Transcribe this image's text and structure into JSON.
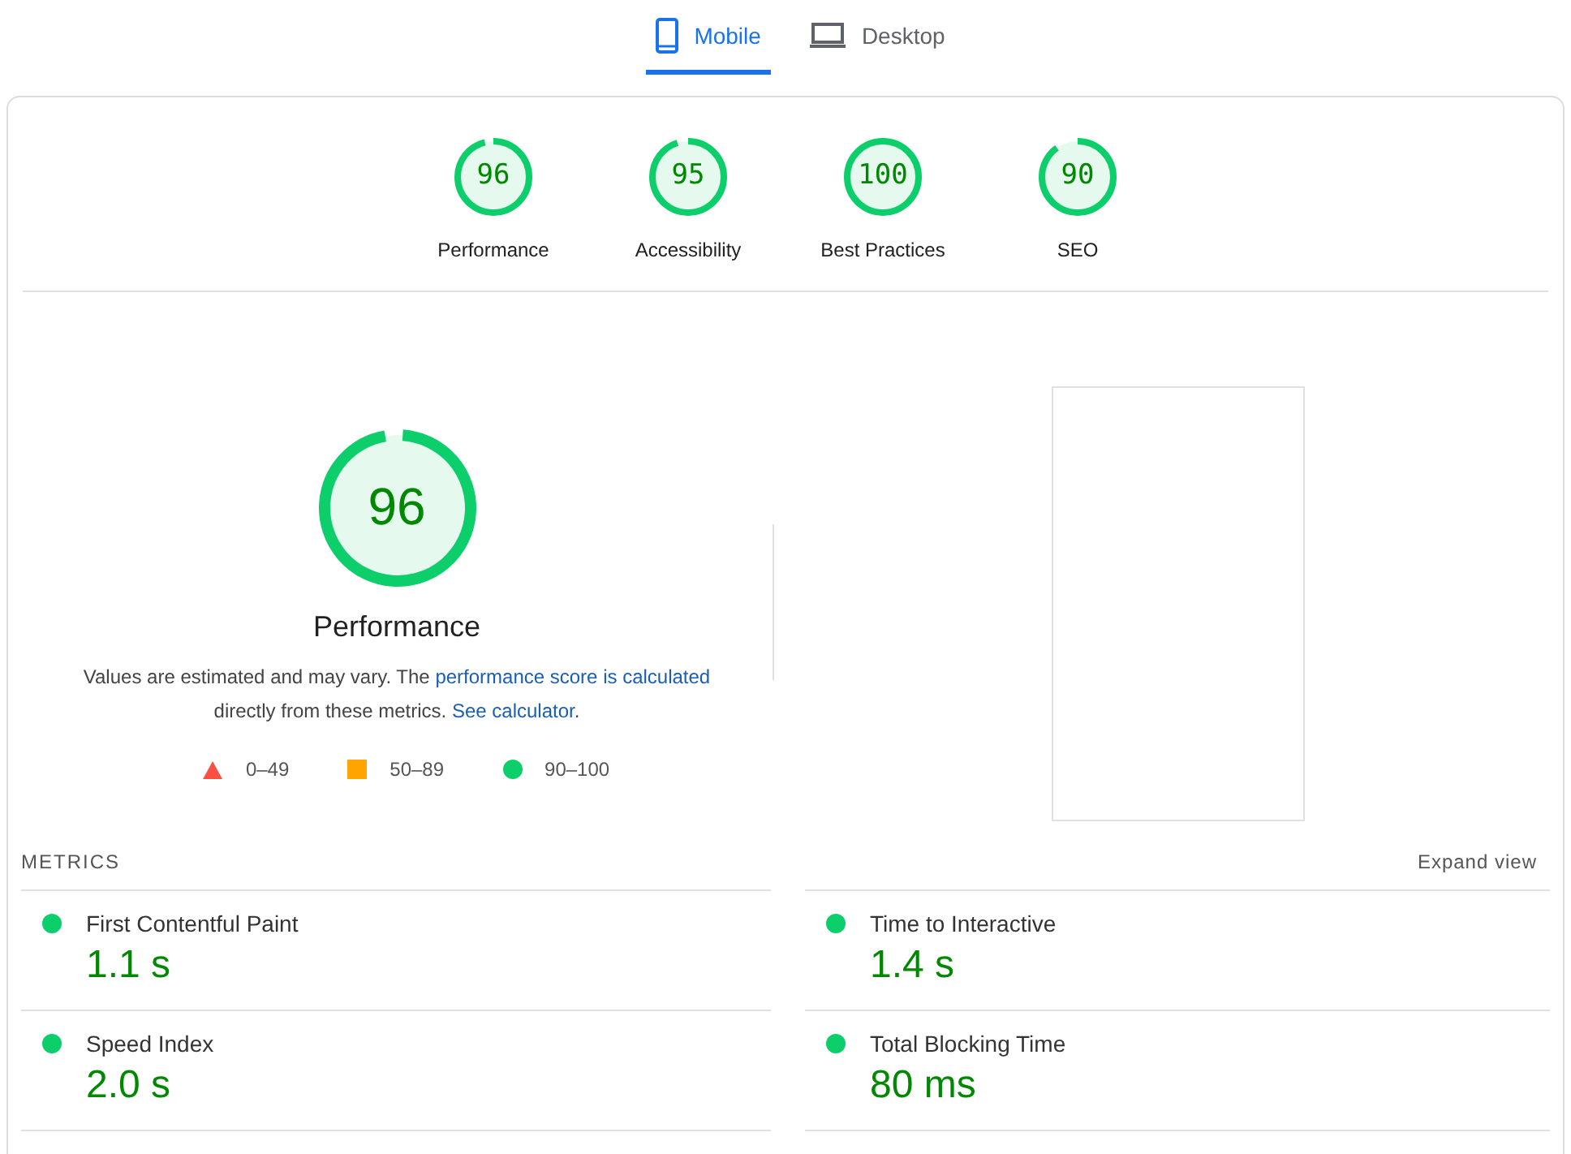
{
  "tabs": [
    {
      "label": "Mobile",
      "kind": "mobile",
      "selected": true
    },
    {
      "label": "Desktop",
      "kind": "desktop",
      "selected": false
    }
  ],
  "categories": [
    {
      "score": "96",
      "label": "Performance",
      "level": 0.96
    },
    {
      "score": "95",
      "label": "Accessibility",
      "level": 0.95
    },
    {
      "score": "100",
      "label": "Best Practices",
      "level": 1.0
    },
    {
      "score": "90",
      "label": "SEO",
      "level": 0.9
    }
  ],
  "hero": {
    "score": "96",
    "level": 0.96,
    "title": "Performance",
    "description": [
      {
        "kind": "text",
        "text": "Values are estimated and may vary. The"
      },
      {
        "kind": "link",
        "text": "performance score is calculated"
      },
      {
        "kind": "text",
        "text": "directly from these metrics."
      },
      {
        "kind": "link",
        "text": "See calculator"
      },
      {
        "kind": "text",
        "text": "."
      }
    ]
  },
  "legend": [
    {
      "kind": "fail",
      "label": "0–49"
    },
    {
      "kind": "average",
      "label": "50–89"
    },
    {
      "kind": "pass",
      "label": "90–100"
    }
  ],
  "metrics": {
    "heading": "METRICS",
    "expand": "Expand view",
    "items": [
      {
        "name": "First Contentful Paint",
        "value": "1.1 s",
        "kind": "pass"
      },
      {
        "name": "Time to Interactive",
        "value": "1.4 s",
        "kind": "pass"
      },
      {
        "name": "Speed Index",
        "value": "2.0 s",
        "kind": "pass"
      },
      {
        "name": "Total Blocking Time",
        "value": "80 ms",
        "kind": "pass"
      }
    ]
  }
}
